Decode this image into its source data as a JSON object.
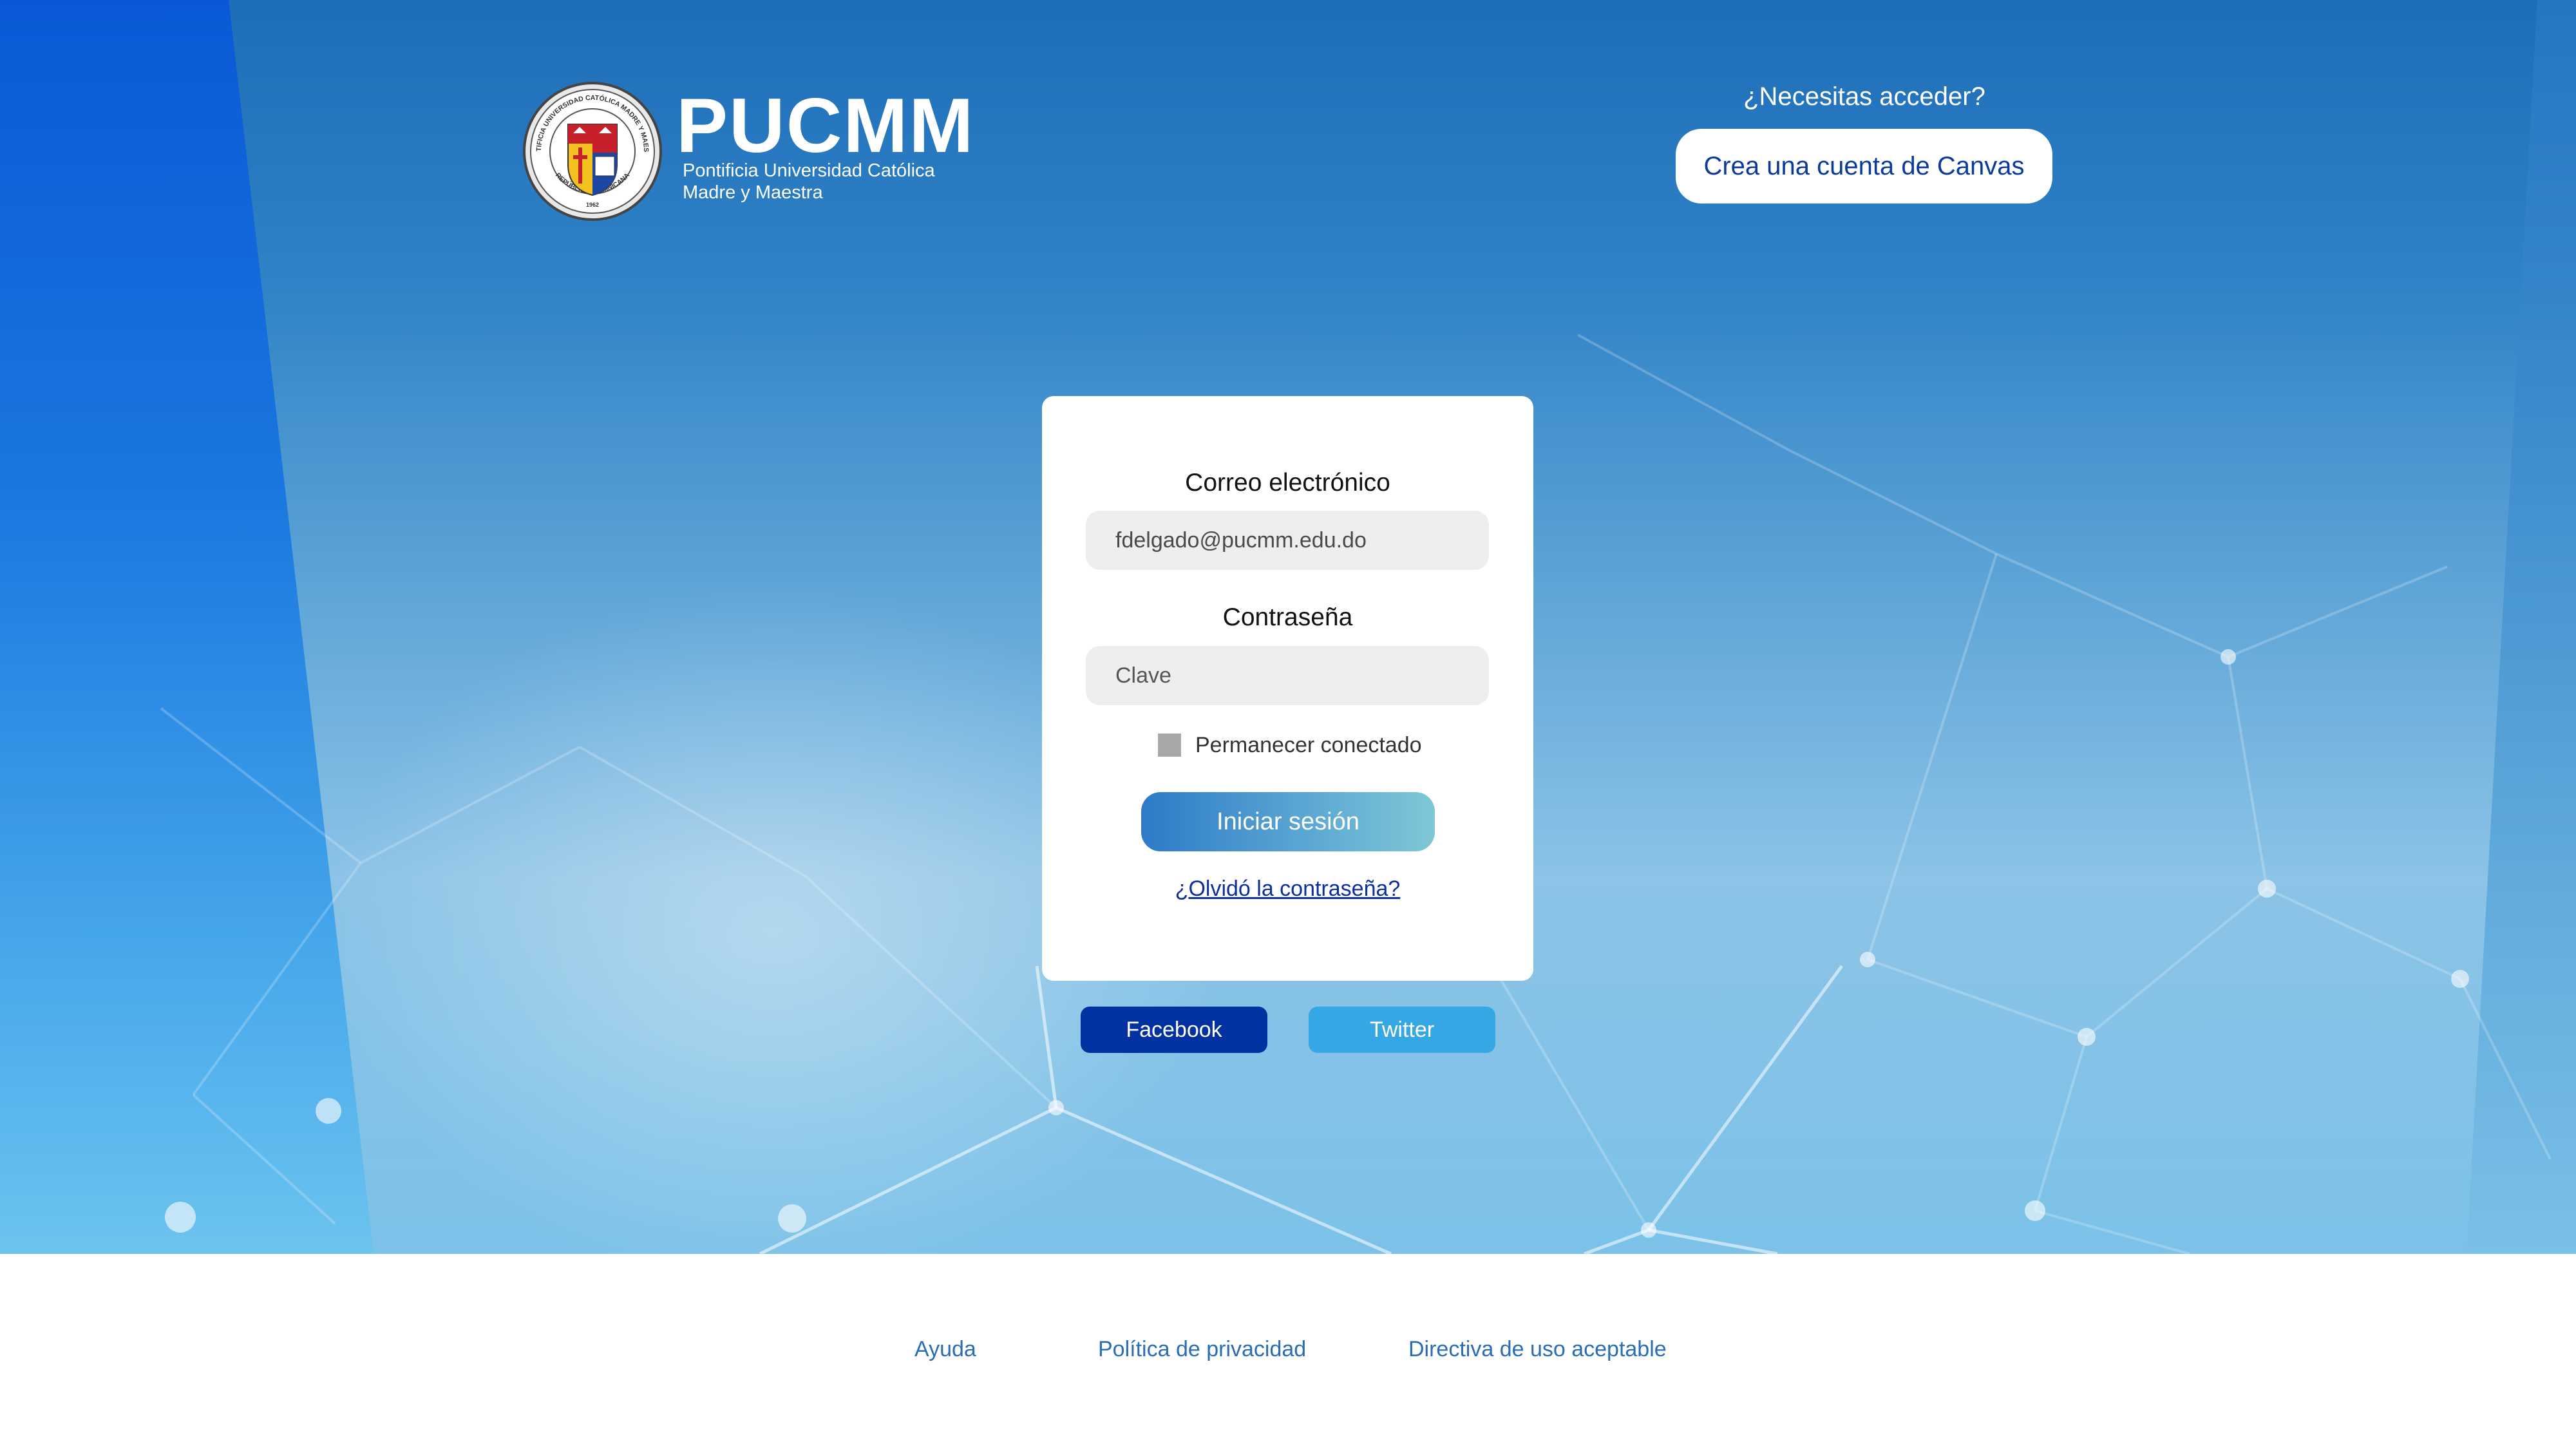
{
  "header": {
    "logo": {
      "wordmark": "PUCMM",
      "subtitle_line1": "Pontificia Universidad Católica",
      "subtitle_line2": "Madre y Maestra",
      "seal_text_top": "PONTIFICIA UNIVERSIDAD CATÓLICA MADRE Y MAESTRA",
      "seal_text_bottom": "REPÚBLICA DOMINICANA",
      "seal_year": "1962"
    },
    "access_prompt": "¿Necesitas acceder?",
    "create_account_label": "Crea una cuenta de Canvas"
  },
  "login": {
    "email_label": "Correo electrónico",
    "email_value": "fdelgado@pucmm.edu.do",
    "password_label": "Contraseña",
    "password_placeholder": "Clave",
    "remember_label": "Permanecer conectado",
    "remember_checked": false,
    "submit_label": "Iniciar sesión",
    "forgot_label": "¿Olvidó la contraseña?"
  },
  "social": {
    "facebook_label": "Facebook",
    "twitter_label": "Twitter"
  },
  "footer": {
    "links": [
      "Ayuda",
      "Política de privacidad",
      "Directiva de uso aceptable"
    ]
  },
  "colors": {
    "brand_blue": "#0232a2",
    "twitter_blue": "#35a7e4",
    "link_blue": "#2a6db4",
    "input_bg": "#eeeeee"
  },
  "icons": {
    "seal": "university-seal-icon"
  }
}
